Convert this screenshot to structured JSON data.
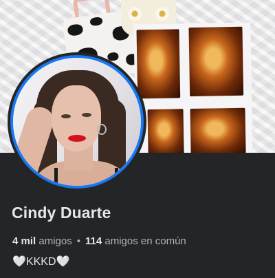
{
  "profile": {
    "name": "Cindy Duarte",
    "friends_count": "4 mil",
    "friends_label": "amigos",
    "separator": "•",
    "mutual_count": "114",
    "mutual_label": "amigos en común",
    "bio": "🤍KKKD🤍"
  },
  "colors": {
    "background": "#242526",
    "primary_text": "#e4e6eb",
    "secondary_text": "#b0b3b8",
    "avatar_ring": "#1877f2"
  },
  "images": {
    "cover": "cover-photo",
    "avatar": "profile-picture"
  }
}
